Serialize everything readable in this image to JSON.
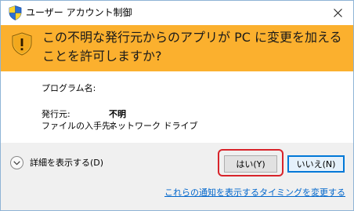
{
  "window": {
    "title": "ユーザー アカウント制御",
    "close_glyph": "✕"
  },
  "banner": {
    "question": "この不明な発行元からのアプリが PC に変更を加えることを許可しますか?",
    "color": "#fbb02e"
  },
  "info": {
    "program_name_label": "プログラム名:",
    "program_name_value": "",
    "publisher_label": "発行元:",
    "publisher_value": "不明",
    "origin_label": "ファイルの入手先:",
    "origin_value": "ネットワーク ドライブ"
  },
  "footer": {
    "details_label": "詳細を表示する(D)",
    "yes_label": "はい(Y)",
    "no_label": "いいえ(N)",
    "notification_link": "これらの通知を表示するタイミングを変更する",
    "highlight_color": "#d8232a",
    "link_color": "#0066cc"
  },
  "icons": {
    "title_icon": "shield-icon",
    "banner_icon": "warning-shield-icon",
    "close_icon": "close-icon",
    "details_icon": "chevron-down-icon"
  }
}
